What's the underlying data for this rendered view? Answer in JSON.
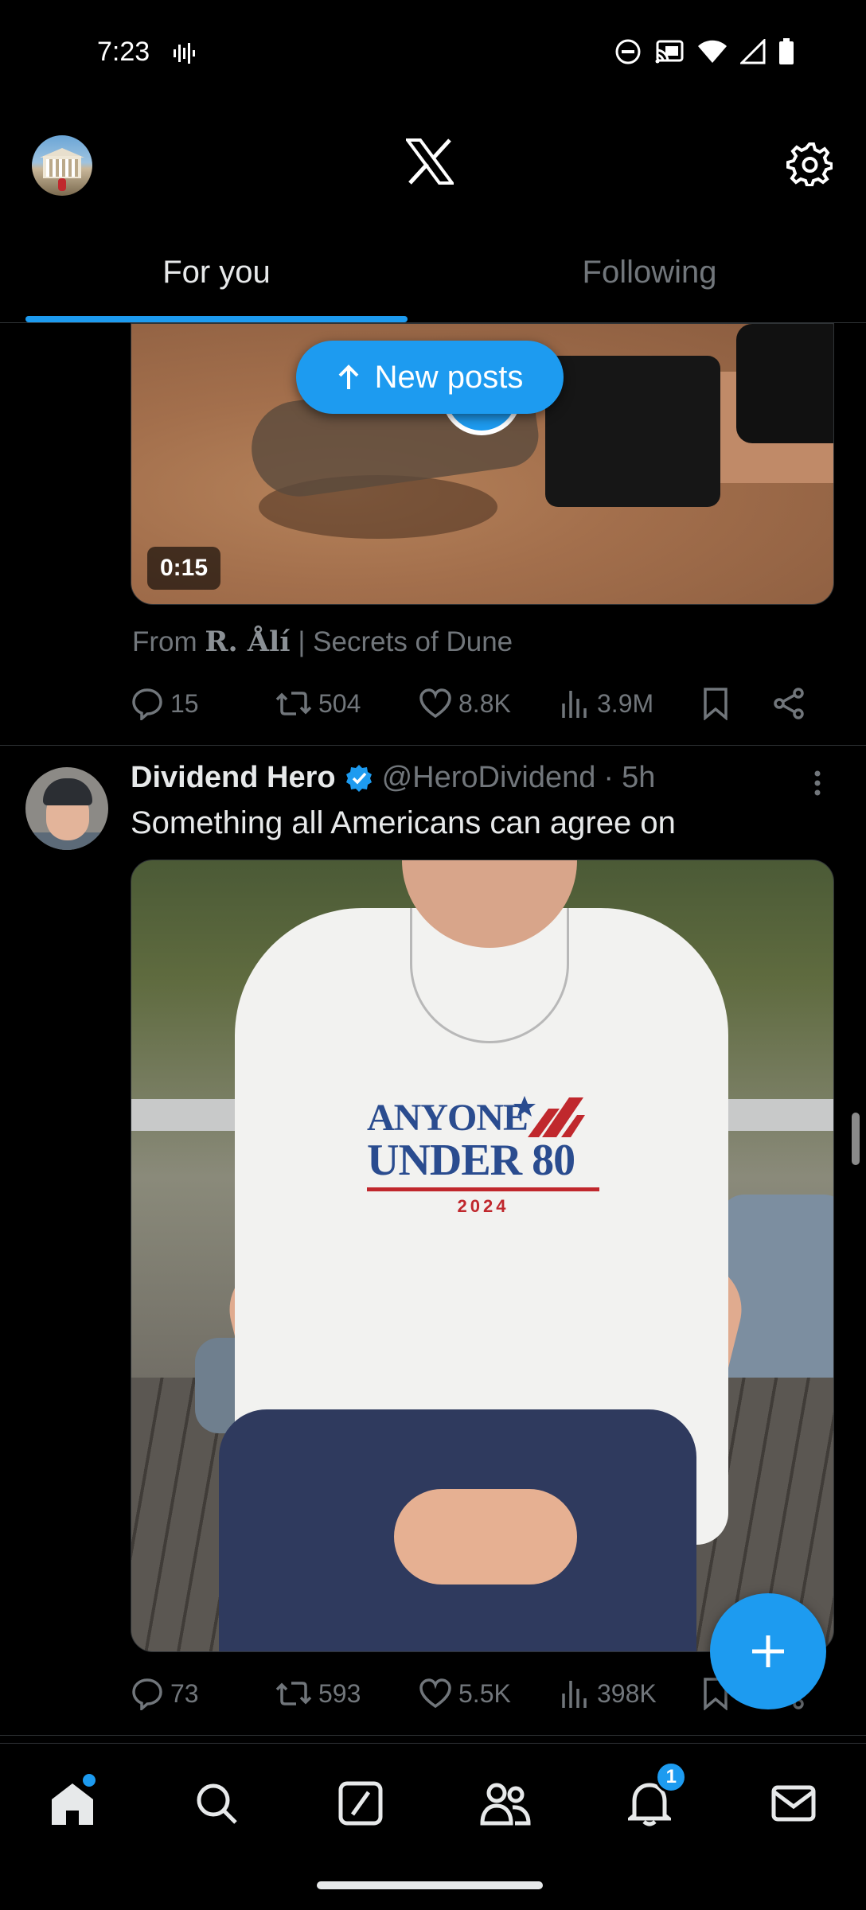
{
  "status_bar": {
    "time": "7:23"
  },
  "header": {
    "logo": "x-logo-icon",
    "settings": "gear-icon"
  },
  "tabs": [
    {
      "label": "For you",
      "active": true
    },
    {
      "label": "Following",
      "active": false
    }
  ],
  "new_posts_button": {
    "label": "New posts"
  },
  "post1": {
    "video_duration": "0:15",
    "from_prefix": "From",
    "from_name": "R. Ålí",
    "from_suffix": "| Secrets of Dune",
    "stats": {
      "replies": "15",
      "reposts": "504",
      "likes": "8.8K",
      "views": "3.9M"
    }
  },
  "post2": {
    "author_name": "Dividend Hero",
    "verified": true,
    "handle": "@HeroDividend",
    "separator": "·",
    "time": "5h",
    "text": "Something all Americans can agree on",
    "image_text": {
      "line1": "ANYONE",
      "line2": "UNDER 80",
      "year": "2024"
    },
    "stats": {
      "replies": "73",
      "reposts": "593",
      "likes": "5.5K",
      "views": "398K"
    }
  },
  "bottom_nav": {
    "items": [
      "home-icon",
      "search-icon",
      "grok-icon",
      "communities-icon",
      "notifications-icon",
      "messages-icon"
    ],
    "notifications_badge": "1"
  },
  "colors": {
    "accent": "#1d9bf0",
    "background": "#000000",
    "muted": "#71767b",
    "text": "#e7e9ea"
  }
}
